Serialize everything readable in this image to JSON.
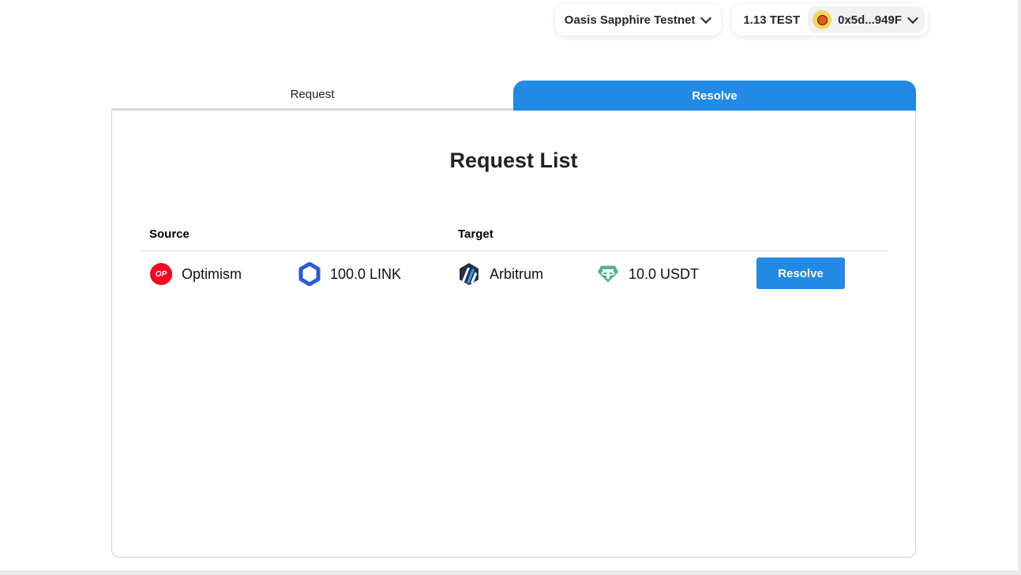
{
  "header": {
    "network": "Oasis Sapphire Testnet",
    "balance": "1.13 TEST",
    "address": "0x5d...949F"
  },
  "tabs": [
    {
      "label": "Request",
      "active": false
    },
    {
      "label": "Resolve",
      "active": true
    }
  ],
  "main": {
    "title": "Request List",
    "columns": {
      "source": "Source",
      "target": "Target"
    },
    "rows": [
      {
        "source_chain": "Optimism",
        "source_chain_icon": "optimism-icon",
        "source_amount": "100.0 LINK",
        "source_token_icon": "chainlink-icon",
        "target_chain": "Arbitrum",
        "target_chain_icon": "arbitrum-icon",
        "target_amount": "10.0 USDT",
        "target_token_icon": "tether-icon",
        "action": "Resolve"
      }
    ]
  },
  "icons": {
    "optimism_badge": "OP"
  },
  "colors": {
    "accent": "#2289e5",
    "optimism": "#ff0420",
    "chainlink": "#2a5ada",
    "arbitrum": "#213147",
    "tether": "#50af95"
  }
}
